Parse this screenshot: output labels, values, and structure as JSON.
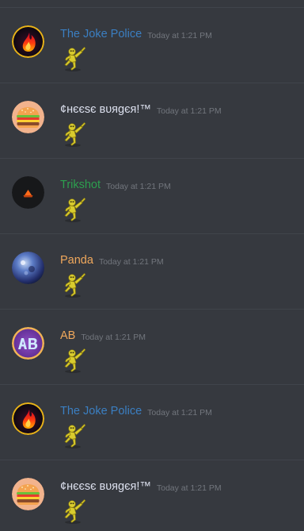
{
  "colors": {
    "background": "#36393f",
    "divider": "#40444b",
    "timestamp": "#72767d"
  },
  "messages": [
    {
      "author": "The Joke Police",
      "author_color": "#3b7fc2",
      "timestamp": "Today at 1:21 PM",
      "avatar": "flame-avatar-icon",
      "content_emoji": "dancing-figure-emoji-icon"
    },
    {
      "author": "¢нєєѕє вυяgєя!™",
      "author_color": "#dde1ef",
      "timestamp": "Today at 1:21 PM",
      "avatar": "burger-avatar-icon",
      "content_emoji": "dancing-figure-emoji-icon"
    },
    {
      "author": "Trikshot",
      "author_color": "#2c9f4e",
      "timestamp": "Today at 1:21 PM",
      "avatar": "dark-orange-shape-avatar-icon",
      "content_emoji": "dancing-figure-emoji-icon"
    },
    {
      "author": "Panda",
      "author_color": "#f0a85c",
      "timestamp": "Today at 1:21 PM",
      "avatar": "blue-orb-avatar-icon",
      "content_emoji": "dancing-figure-emoji-icon"
    },
    {
      "author": "AB",
      "author_color": "#f0a85c",
      "timestamp": "Today at 1:21 PM",
      "avatar": "ab-letters-avatar-icon",
      "content_emoji": "dancing-figure-emoji-icon"
    },
    {
      "author": "The Joke Police",
      "author_color": "#3b7fc2",
      "timestamp": "Today at 1:21 PM",
      "avatar": "flame-avatar-icon",
      "content_emoji": "dancing-figure-emoji-icon"
    },
    {
      "author": "¢нєєѕє вυяgєя!™",
      "author_color": "#dde1ef",
      "timestamp": "Today at 1:21 PM",
      "avatar": "burger-avatar-icon",
      "content_emoji": "dancing-figure-emoji-icon"
    }
  ]
}
